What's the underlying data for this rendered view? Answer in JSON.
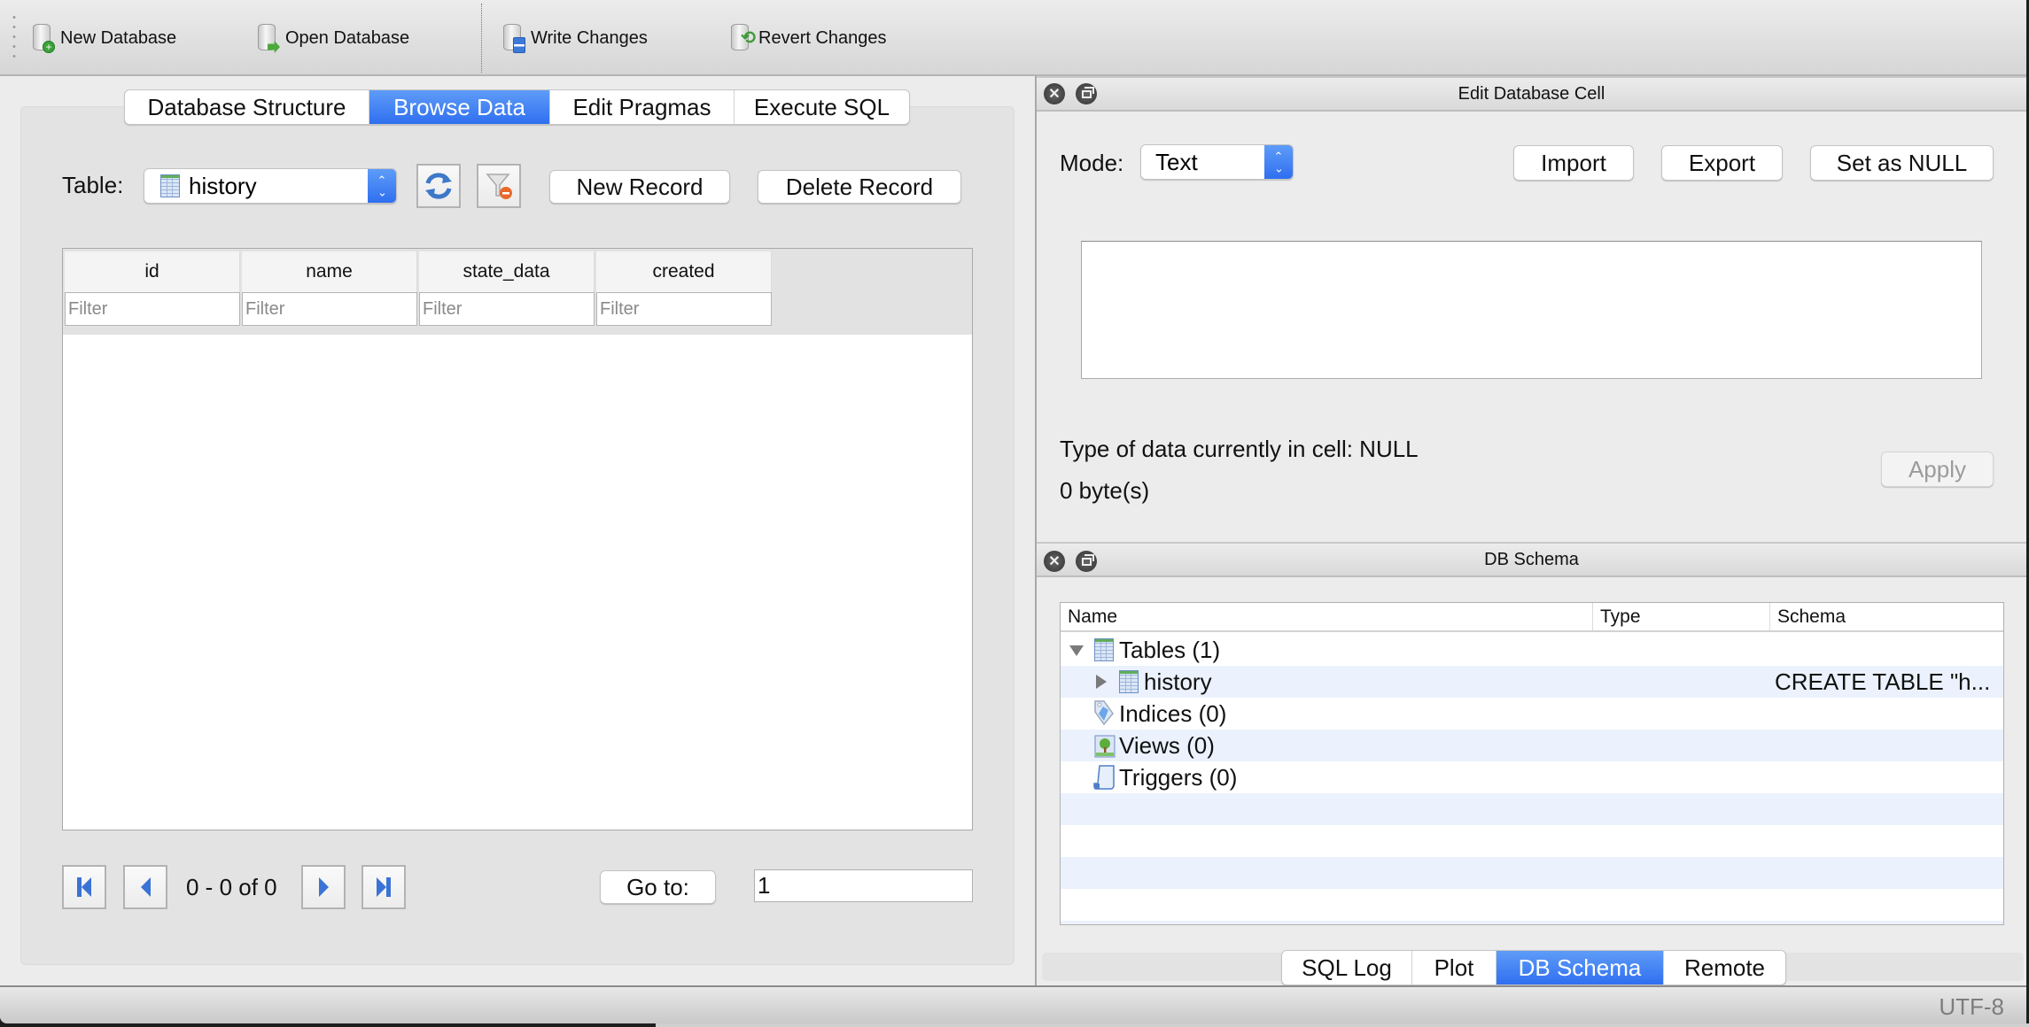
{
  "toolbar": {
    "items": [
      {
        "label": "New Database",
        "icon": "new-database-icon"
      },
      {
        "label": "Open Database",
        "icon": "open-database-icon"
      },
      {
        "label": "Write Changes",
        "icon": "write-changes-icon"
      },
      {
        "label": "Revert Changes",
        "icon": "revert-changes-icon"
      }
    ]
  },
  "main_tabs": [
    {
      "label": "Database Structure",
      "active": false
    },
    {
      "label": "Browse Data",
      "active": true
    },
    {
      "label": "Edit Pragmas",
      "active": false
    },
    {
      "label": "Execute SQL",
      "active": false
    }
  ],
  "browse": {
    "table_label": "Table:",
    "table_value": "history",
    "refresh_icon": "refresh-icon",
    "clear_filters_icon": "clear-filters-icon",
    "new_record": "New Record",
    "delete_record": "Delete Record",
    "columns": [
      "id",
      "name",
      "state_data",
      "created"
    ],
    "filter_placeholder": "Filter",
    "rows": [],
    "pagination": {
      "range_text": "0 - 0 of 0",
      "goto_label": "Go to:",
      "goto_value": "1"
    }
  },
  "edit_cell": {
    "title": "Edit Database Cell",
    "mode_label": "Mode:",
    "mode_value": "Text",
    "import": "Import",
    "export": "Export",
    "set_null": "Set as NULL",
    "cell_value": "",
    "type_text": "Type of data currently in cell: NULL",
    "size_text": "0 byte(s)",
    "apply": "Apply"
  },
  "db_schema": {
    "title": "DB Schema",
    "headers": [
      "Name",
      "Type",
      "Schema"
    ],
    "tree": [
      {
        "name": "Tables (1)",
        "icon": "table-icon",
        "expanded": true,
        "level": 0,
        "type": "",
        "schema": ""
      },
      {
        "name": "history",
        "icon": "table-icon",
        "expanded": false,
        "level": 1,
        "type": "",
        "schema": "CREATE TABLE \"h..."
      },
      {
        "name": "Indices (0)",
        "icon": "index-tag-icon",
        "level": 0,
        "type": "",
        "schema": ""
      },
      {
        "name": "Views (0)",
        "icon": "view-picture-icon",
        "level": 0,
        "type": "",
        "schema": ""
      },
      {
        "name": "Triggers (0)",
        "icon": "trigger-scroll-icon",
        "level": 0,
        "type": "",
        "schema": ""
      }
    ]
  },
  "bottom_tabs": [
    {
      "label": "SQL Log",
      "active": false
    },
    {
      "label": "Plot",
      "active": false
    },
    {
      "label": "DB Schema",
      "active": true
    },
    {
      "label": "Remote",
      "active": false
    }
  ],
  "status": {
    "encoding": "UTF-8"
  },
  "colors": {
    "accent": "#2f6ff0",
    "panel_bg": "#ececec",
    "group_bg": "#e3e3e3",
    "alt_row": "#ebf2fd"
  }
}
